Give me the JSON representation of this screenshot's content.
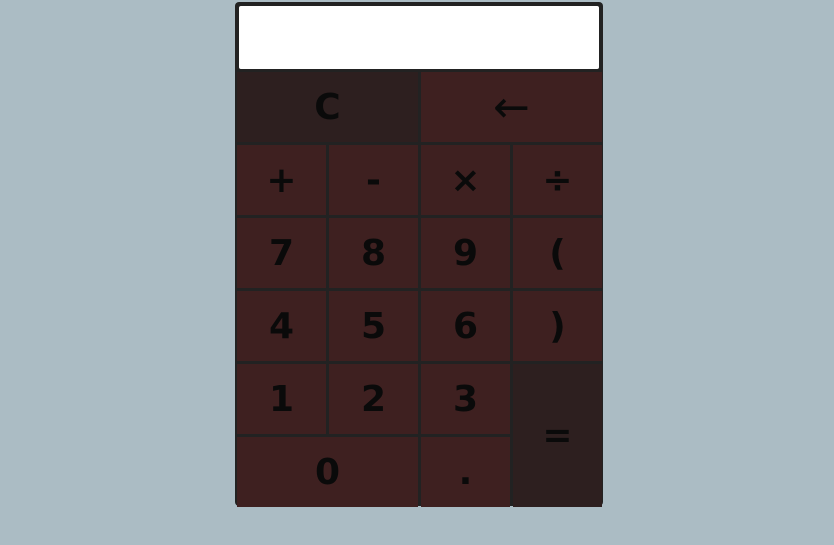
{
  "display": {
    "value": ""
  },
  "keys": {
    "clear": "C",
    "backspace": "←",
    "plus": "+",
    "minus": "-",
    "multiply": "×",
    "divide": "÷",
    "seven": "7",
    "eight": "8",
    "nine": "9",
    "open_paren": "(",
    "four": "4",
    "five": "5",
    "six": "6",
    "close_paren": ")",
    "one": "1",
    "two": "2",
    "three": "3",
    "equals": "=",
    "zero": "0",
    "decimal": "."
  },
  "colors": {
    "background": "#abbcc4",
    "frame": "#222222",
    "key": "#3e2020",
    "key_dark": "#2d1f1f",
    "display": "#ffffff",
    "key_text": "#0a0a0a"
  }
}
